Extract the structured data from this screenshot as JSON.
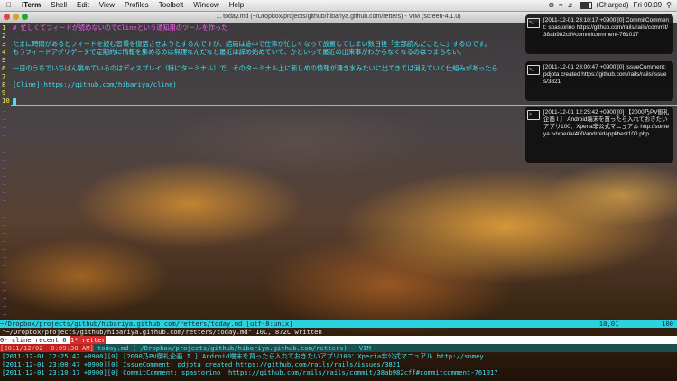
{
  "menubar": {
    "apple_icon": "apple-icon",
    "items": [
      "iTerm",
      "Shell",
      "Edit",
      "View",
      "Profiles",
      "Toolbelt",
      "Window",
      "Help"
    ],
    "status": {
      "battery": "(Charged)",
      "clock": "Fri 00:09"
    }
  },
  "window": {
    "title": "1. today.md (~/Dropbox/projects/github/hibariya.github.com/retters) - VIM (screen-4.1.0)"
  },
  "editor": {
    "lines": [
      {
        "num": "1",
        "text": "# 忙しくてフィードが読めないのでClineという通知用のツールを作った",
        "color": "mag"
      },
      {
        "num": "2",
        "text": "",
        "color": "mag"
      },
      {
        "num": "3",
        "text": "たまに時間があるとフィードを読む習慣を復活させようとするんですが、結局は途中で仕事が忙しくなって放置してしまい数日後「全部読んだことに」するのです。",
        "color": "cyan"
      },
      {
        "num": "4",
        "text": "もうフィードアグリゲータで定期的に情報を集めるのは無理なんだなと最近は諦め始めていて、かといって最近の出来事がわからなくなるのはつまらない。",
        "color": "cyan"
      },
      {
        "num": "5",
        "text": "",
        "color": "cyan"
      },
      {
        "num": "6",
        "text": "一日のうちでいちばん眺めているのはディスプレイ（特にターミナル）で、そのターミナル上に新しめの情報が湧き水みたいに出てきては消えていく仕組みがあったら",
        "color": "cyan"
      },
      {
        "num": "7",
        "text": "",
        "color": "cyan"
      },
      {
        "num": "8",
        "text": "[Cline](https://github.com/hibariya/cline)",
        "color": "cyan"
      },
      {
        "num": "9",
        "text": "",
        "color": "cyan"
      },
      {
        "num": "10",
        "text": "",
        "color": "cyan"
      }
    ],
    "status_path": "~/Dropbox/projects/github/hibariya.github.com/retters/today.md [utf-8:unix]",
    "status_pos": "10,01",
    "status_pct": "100",
    "written_msg": "\"~/Dropbox/projects/github/hibariya.github.com/retters/today.md\" 10L, 872C written"
  },
  "screen": {
    "window_list_prefix": "0- cline recent 6 ",
    "window_list_current": "1* retter",
    "date_stamp": "[2011/12/02  0:09:38 AM]",
    "title": "today.md (~/Dropbox/projects/github/hibariya.github.com/retters) - VIM"
  },
  "log": [
    "[2011-12-01 12:25:42 +0900][0] [2000乃PV御礼企画 I ] Android端末を買ったら入れておきたいアプリ100：Xperia非公式マニュアル http://somey",
    "[2011-12-01 23:00:47 +0900][0] IssueComment: pdjota created https://github.com/rails/rails/issues/3821",
    "[2011-12-01 23:10:17 +0900][0] CommitComment: spastorino  https://github.com/rails/rails/commit/38ab982cff#commitcomment-761017"
  ],
  "notifications": [
    {
      "text": "[2011-12-01 23:10:17 +0900][0] CommitComment: spastorino  https://github.com/rails/rails/commit/38ab982cff#commitcomment-761017"
    },
    {
      "text": "[2011-12-01 23:00:47 +0900][0] IssueComment: pdjota created https://github.com/rails/rails/issues/3821"
    },
    {
      "text": "[2011-12-01 12:25:42 +0900][0] 【2000乃PV御礼企画 I 】 Android端末を買ったら入れておきたいアプリ100：Xperia非公式マニュアル http://someya.tv/xperia/400/androidapplibest100.php"
    }
  ]
}
